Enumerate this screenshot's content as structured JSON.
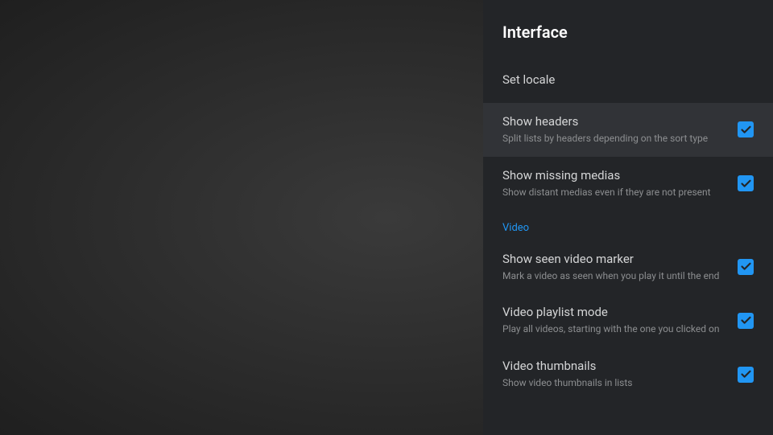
{
  "panel": {
    "title": "Interface"
  },
  "items": {
    "setLocale": {
      "title": "Set locale"
    },
    "showHeaders": {
      "title": "Show headers",
      "subtitle": "Split lists by headers depending on the sort type",
      "checked": true
    },
    "showMissing": {
      "title": "Show missing medias",
      "subtitle": "Show distant medias even if they are not present",
      "checked": true
    },
    "videoSection": {
      "label": "Video"
    },
    "seenMarker": {
      "title": "Show seen video marker",
      "subtitle": "Mark a video as seen when you play it until the end",
      "checked": true
    },
    "playlistMode": {
      "title": "Video playlist mode",
      "subtitle": "Play all videos, starting with the one you clicked on",
      "checked": true
    },
    "thumbnails": {
      "title": "Video thumbnails",
      "subtitle": "Show video thumbnails in lists",
      "checked": true
    }
  }
}
